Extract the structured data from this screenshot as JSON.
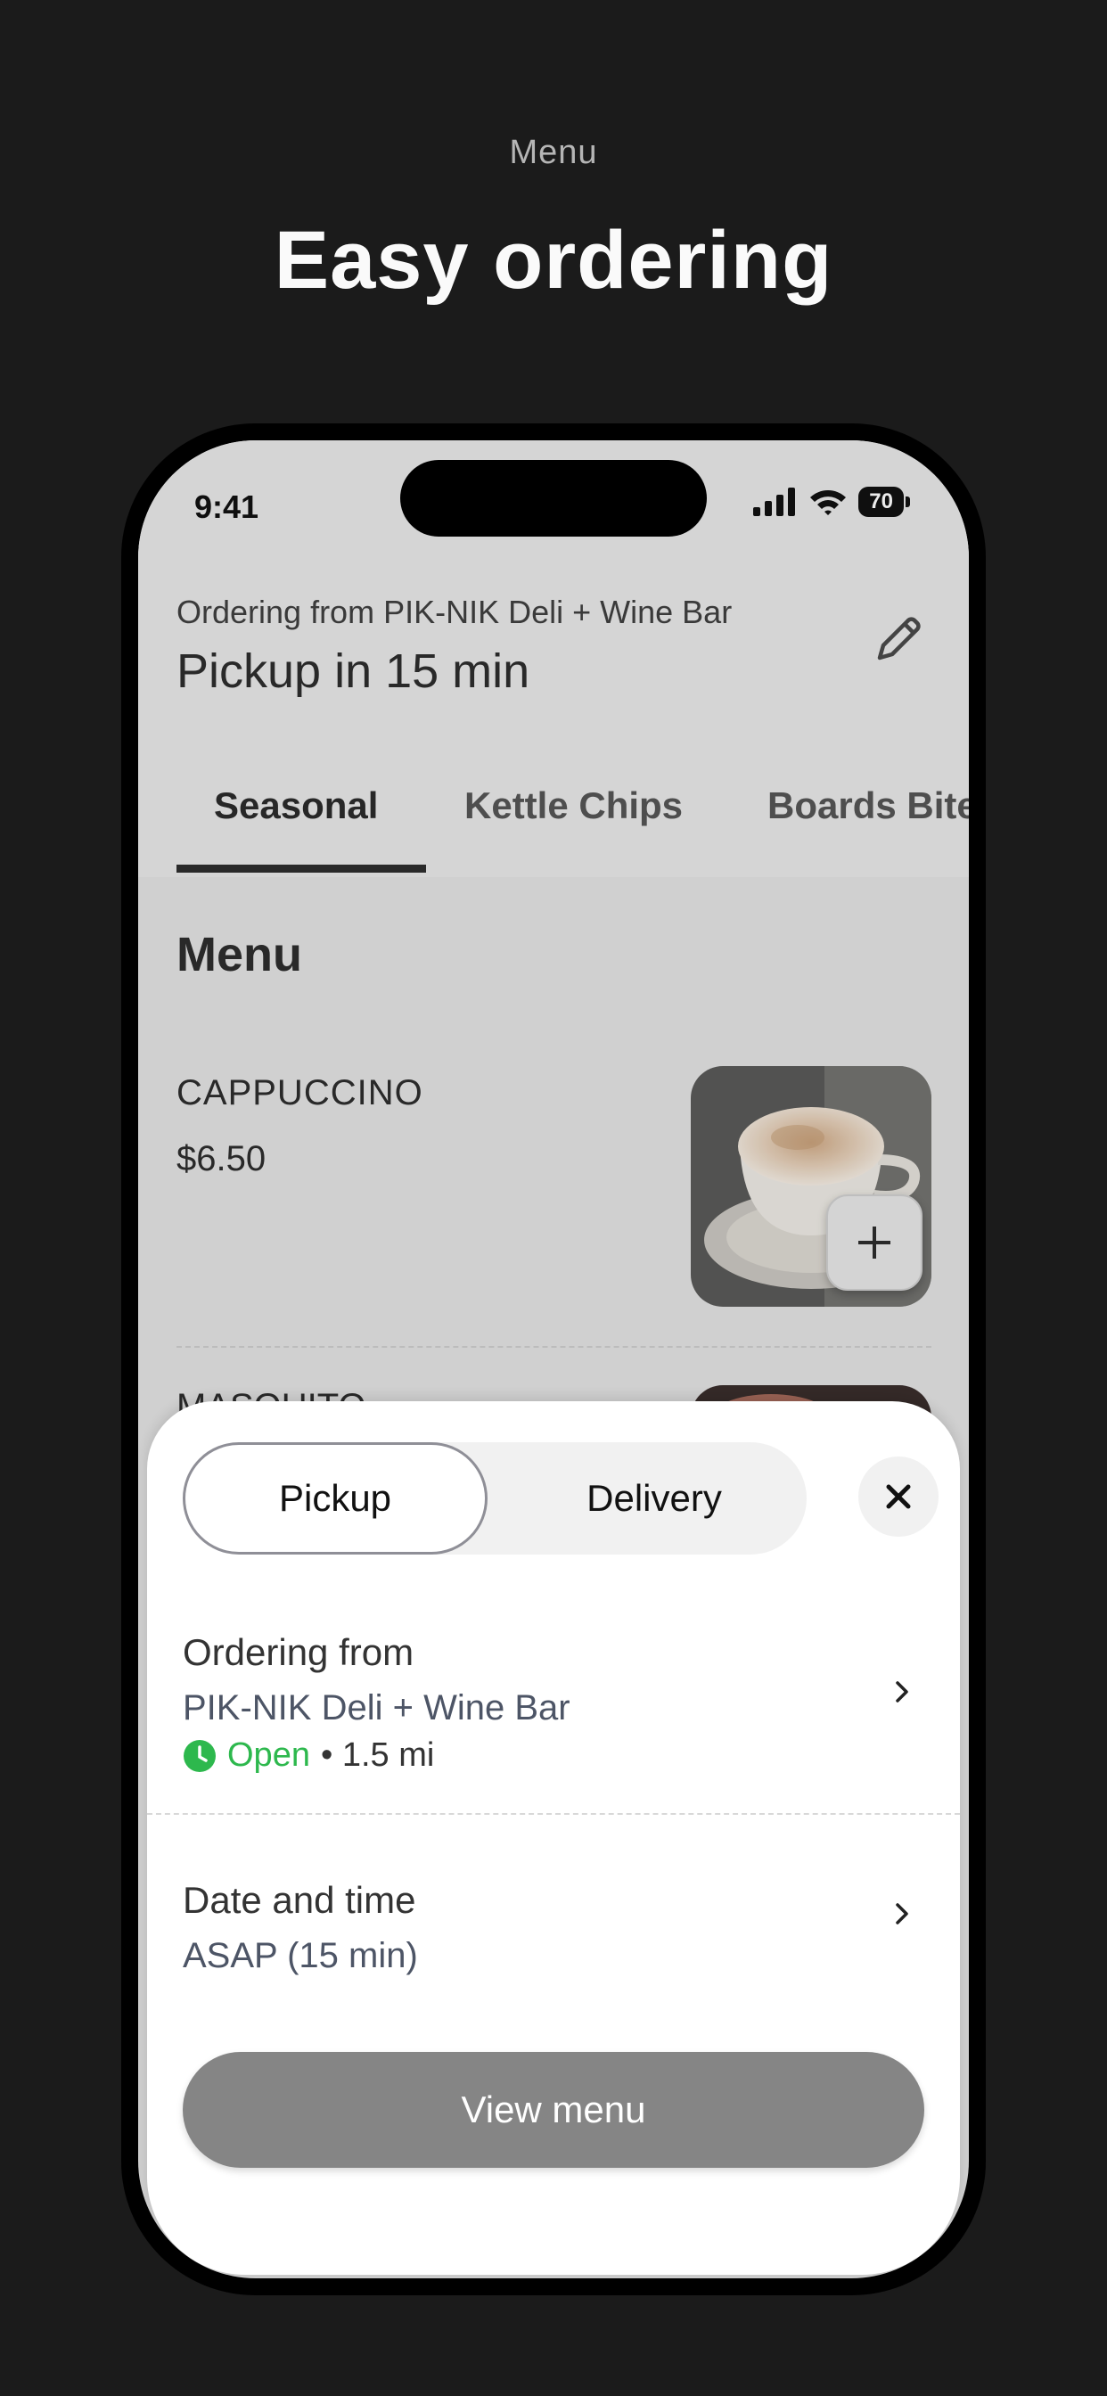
{
  "promo": {
    "eyebrow": "Menu",
    "headline": "Easy ordering"
  },
  "status_bar": {
    "time": "9:41",
    "battery": "70"
  },
  "header": {
    "ordering_from": "Ordering from PIK-NIK Deli + Wine Bar",
    "pickup_time": "Pickup in 15 min",
    "edit_icon": "pencil-icon"
  },
  "tabs": [
    {
      "label": "Seasonal",
      "active": true
    },
    {
      "label": "Kettle Chips",
      "active": false
    },
    {
      "label": "Boards Bite",
      "active": false
    }
  ],
  "menu": {
    "title": "Menu",
    "items": [
      {
        "name": "CAPPUCCINO",
        "price": "$6.50",
        "add_icon": "plus-icon"
      },
      {
        "name": "MASQUITO"
      }
    ]
  },
  "sheet": {
    "mode_options": [
      "Pickup",
      "Delivery"
    ],
    "selected_mode": "Pickup",
    "close_icon": "close-icon",
    "ordering_from_label": "Ordering from",
    "store_name": "PIK-NIK Deli + Wine Bar",
    "open_status": "Open",
    "distance": "• 1.5 mi",
    "date_time_label": "Date and time",
    "date_time_value": "ASAP (15 min)",
    "cta": "View menu"
  },
  "colors": {
    "background": "#1b1b1b",
    "open_green": "#2db84d",
    "cta_gray": "#858585"
  }
}
